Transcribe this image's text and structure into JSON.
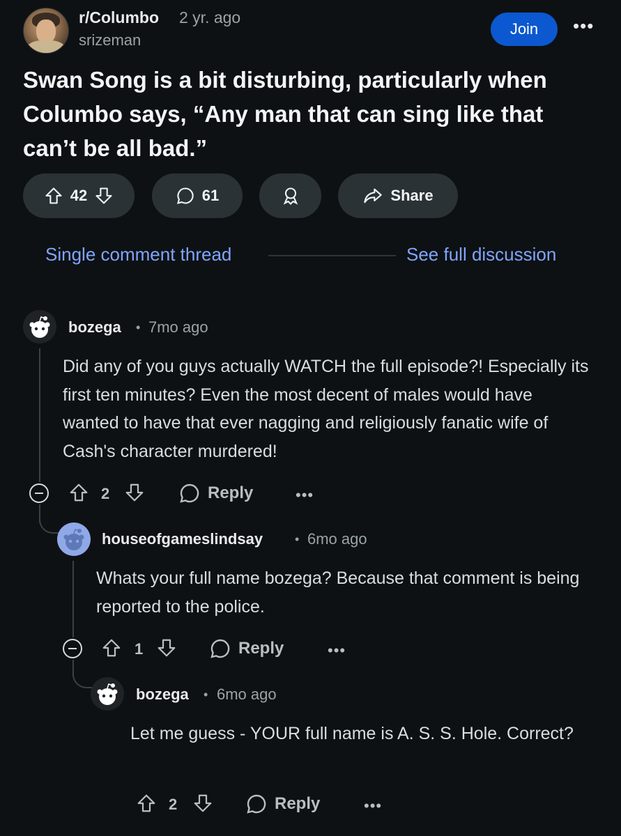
{
  "post": {
    "subreddit": "r/Columbo",
    "time": "2 yr. ago",
    "author": "srizeman",
    "join_label": "Join",
    "more": "•••",
    "title": "Swan Song is a bit disturbing, particularly when Columbo says, “Any man that can sing like that can’t be all bad.”",
    "votes": "42",
    "comments": "61",
    "share_label": "Share",
    "icons": [
      "upvote-icon",
      "downvote-icon",
      "comment-icon",
      "award-icon",
      "share-icon"
    ]
  },
  "thread": {
    "single_label": "Single comment thread",
    "full_label": "See full discussion"
  },
  "comments": [
    {
      "user": "bozega",
      "dot": "•",
      "time": "7mo ago",
      "body": "Did any of you guys actually WATCH the full episode?! Especially its first ten minutes? Even the most decent of males would have wanted to have that ever nagging and religiously fanatic wife of Cash's character murdered!",
      "votes": "2",
      "reply_label": "Reply",
      "more": "•••"
    },
    {
      "user": "houseofgameslindsay",
      "dot": "•",
      "time": "6mo ago",
      "body": "Whats your full name bozega? Because that comment is being reported to the police.",
      "votes": "1",
      "reply_label": "Reply",
      "more": "•••"
    },
    {
      "user": "bozega",
      "dot": "•",
      "time": "6mo ago",
      "body": "Let me guess - YOUR full name is A. S. S. Hole. Correct?",
      "votes": "2",
      "reply_label": "Reply",
      "more": "•••"
    }
  ],
  "colors": {
    "background": "#0e1113",
    "join_button": "#0b58d0",
    "link": "#7fa5ff",
    "pill": "#2a3236"
  }
}
